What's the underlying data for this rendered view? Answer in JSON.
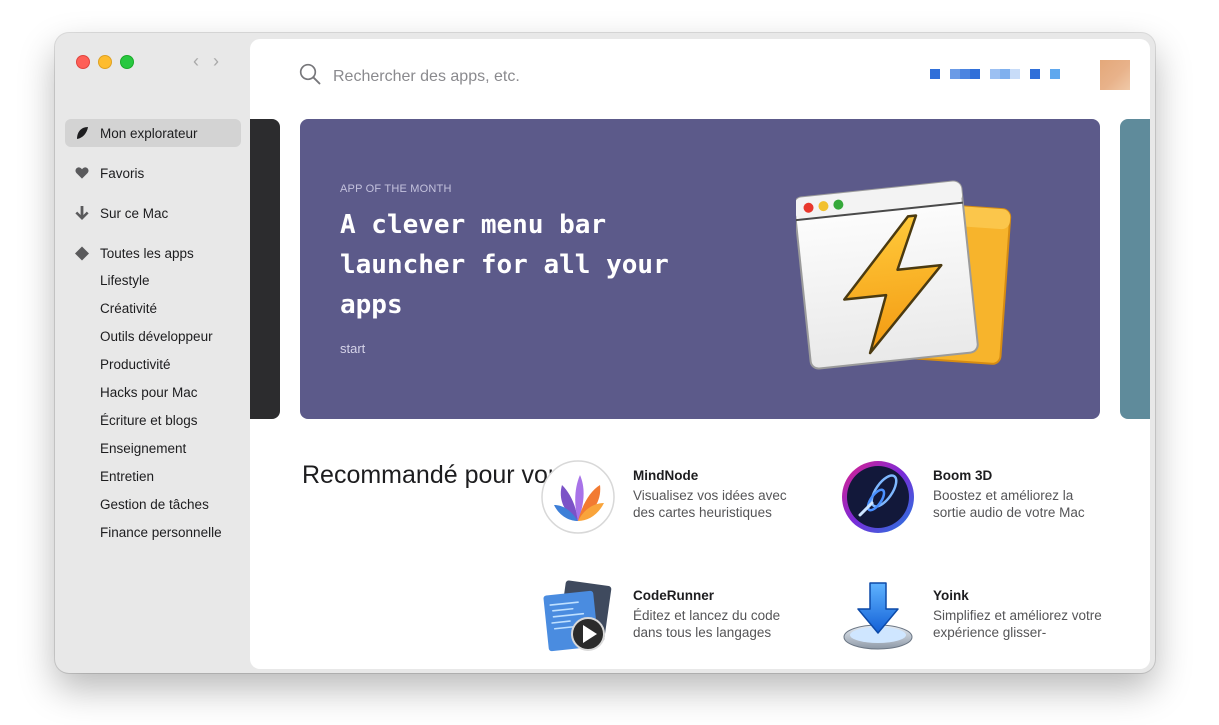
{
  "search": {
    "placeholder": "Rechercher des apps, etc."
  },
  "nav": {
    "back_icon": "chevron-left-icon",
    "forward_icon": "chevron-right-icon"
  },
  "sidebar": {
    "items": [
      {
        "label": "Mon explorateur",
        "icon": "leaf-icon",
        "active": true
      },
      {
        "label": "Favoris",
        "icon": "heart-icon"
      },
      {
        "label": "Sur ce Mac",
        "icon": "arrow-down-icon"
      },
      {
        "label": "Toutes les apps",
        "icon": "diamond-icon"
      }
    ],
    "categories": [
      "Lifestyle",
      "Créativité",
      "Outils développeur",
      "Productivité",
      "Hacks pour Mac",
      "Écriture et blogs",
      "Enseignement",
      "Entretien",
      "Gestion de tâches",
      "Finance personnelle"
    ]
  },
  "hero": {
    "kicker": "APP OF THE MONTH",
    "headline": "A clever menu bar launcher for all your apps",
    "app_name": "start",
    "background": "#5c5a8a"
  },
  "recommended": {
    "title": "Recommandé pour vous",
    "apps": [
      {
        "name": "MindNode",
        "description": "Visualisez vos idées avec des cartes heuristiques",
        "icon": "mindnode-icon"
      },
      {
        "name": "Boom 3D",
        "description": "Boostez et améliorez la sortie audio de votre Mac",
        "icon": "boom3d-icon"
      },
      {
        "name": "CodeRunner",
        "description": "Éditez et lancez du code dans tous les langages",
        "icon": "coderunner-icon"
      },
      {
        "name": "Yoink",
        "description": "Simplifiez et améliorez votre expérience glisser-",
        "icon": "yoink-icon"
      }
    ]
  }
}
